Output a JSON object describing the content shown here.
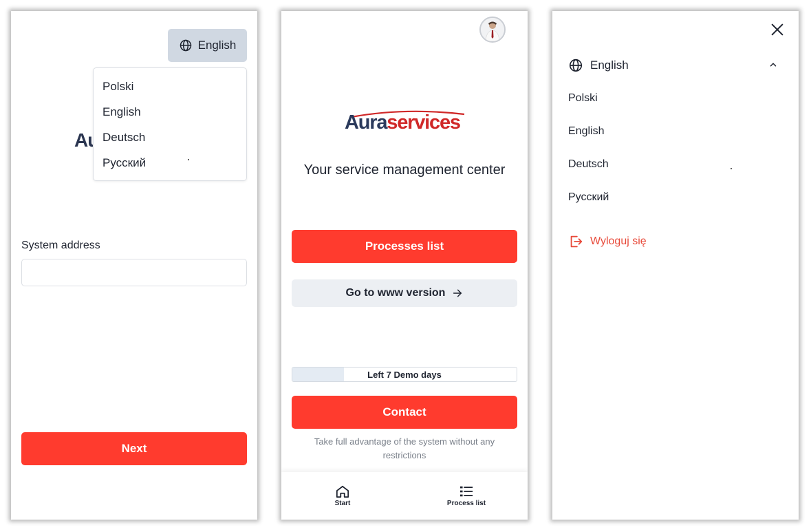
{
  "login_screen": {
    "language_button_label": "English",
    "logo_partial": "Au",
    "language_options": [
      "Polski",
      "English",
      "Deutsch",
      "Русский"
    ],
    "system_address_label": "System address",
    "system_address_value": "",
    "next_label": "Next"
  },
  "home_screen": {
    "logo_part1": "Aura",
    "logo_part2": "services",
    "tagline": "Your service management center",
    "processes_button": "Processes list",
    "www_button": "Go to www version",
    "demo_text": "Left 7 Demo days",
    "demo_progress": 0.23,
    "contact_button": "Contact",
    "hint": "Take full advantage of the system without any restrictions",
    "nav": {
      "start_label": "Start",
      "process_label": "Process list"
    }
  },
  "menu_screen": {
    "current_language": "English",
    "language_options": [
      "Polski",
      "English",
      "Deutsch",
      "Русский"
    ],
    "logout_label": "Wyloguj się"
  },
  "colors": {
    "accent_red": "#ff3b2e",
    "logout_red": "#e84a3a",
    "lang_button_bg": "#d0d8e2"
  }
}
